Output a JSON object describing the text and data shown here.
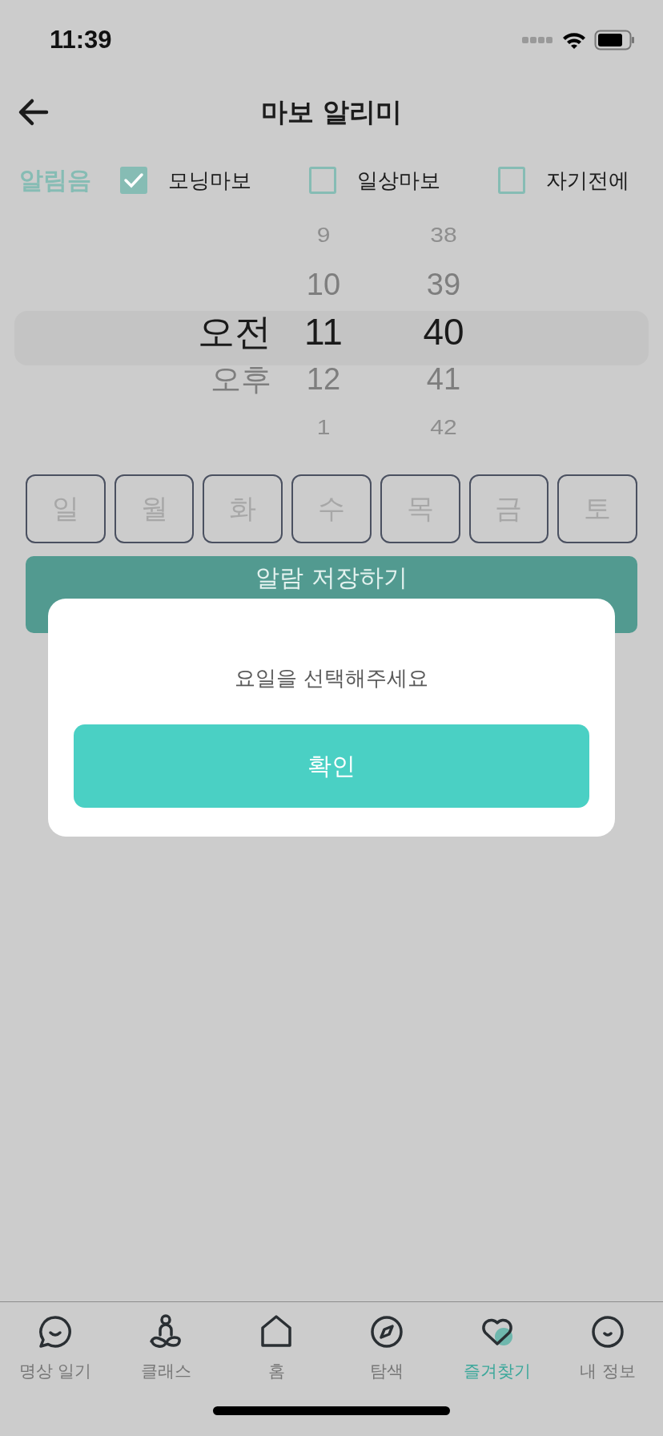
{
  "status_bar": {
    "time": "11:39"
  },
  "header": {
    "title": "마보 알리미"
  },
  "alarm_sound": {
    "label": "알림음",
    "options": [
      {
        "label": "모닝마보",
        "checked": true
      },
      {
        "label": "일상마보",
        "checked": false
      },
      {
        "label": "자기전에",
        "checked": false
      }
    ]
  },
  "time_picker": {
    "columns": [
      {
        "items": [
          {
            "label": "오전",
            "selected": true
          },
          {
            "label": "오후",
            "selected": false
          }
        ]
      },
      {
        "items": [
          {
            "label": "9",
            "selected": false
          },
          {
            "label": "10",
            "selected": false
          },
          {
            "label": "11",
            "selected": true
          },
          {
            "label": "12",
            "selected": false
          },
          {
            "label": "1",
            "selected": false
          }
        ]
      },
      {
        "items": [
          {
            "label": "38",
            "selected": false
          },
          {
            "label": "39",
            "selected": false
          },
          {
            "label": "40",
            "selected": true
          },
          {
            "label": "41",
            "selected": false
          },
          {
            "label": "42",
            "selected": false
          }
        ]
      }
    ]
  },
  "weekdays": [
    {
      "label": "일",
      "selected": false
    },
    {
      "label": "월",
      "selected": false
    },
    {
      "label": "화",
      "selected": false
    },
    {
      "label": "수",
      "selected": false
    },
    {
      "label": "목",
      "selected": false
    },
    {
      "label": "금",
      "selected": false
    },
    {
      "label": "토",
      "selected": false
    }
  ],
  "save_button": {
    "label": "알람 저장하기"
  },
  "dialog": {
    "message": "요일을 선택해주세요",
    "confirm": "확인"
  },
  "tab_bar": [
    {
      "kind": "diary",
      "label": "명상 일기",
      "selected": false
    },
    {
      "kind": "class",
      "label": "클래스",
      "selected": false
    },
    {
      "kind": "home",
      "label": "홈",
      "selected": false
    },
    {
      "kind": "explore",
      "label": "탐색",
      "selected": false
    },
    {
      "kind": "favorite",
      "label": "즐겨찾기",
      "selected": true
    },
    {
      "kind": "profile",
      "label": "내 정보",
      "selected": false
    }
  ]
}
